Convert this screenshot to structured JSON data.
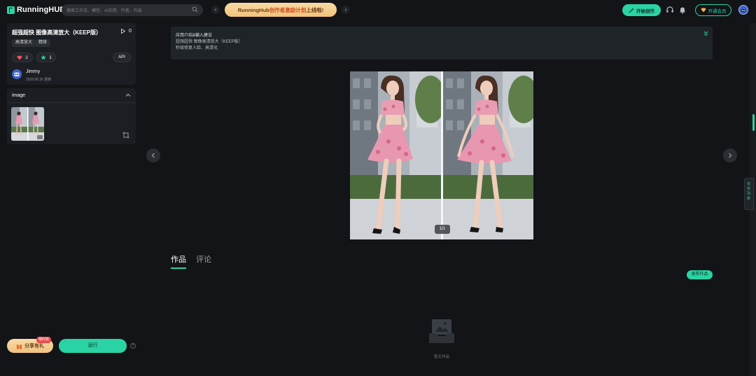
{
  "header": {
    "brand": "RunningHUB",
    "search_placeholder": "搜索工作流、模型、AI应用、作者、作品",
    "promo": {
      "prefix": "RunningHub",
      "highlight": "创作者激励计划",
      "suffix": "上线啦!"
    },
    "create_label": "开始创作",
    "member_label": "开通会员"
  },
  "workflow": {
    "title": "超强超快 图像高清放大（KEEP版）",
    "play_count": "0",
    "tags": [
      "高清放大",
      "精修"
    ],
    "likes": "2",
    "favorites": "1",
    "api_label": "API",
    "author": {
      "name": "Jimmy",
      "updated": "2025.06.26 更新"
    }
  },
  "inputs": {
    "section_label": "image"
  },
  "bottom": {
    "share_label": "分享有礼",
    "share_badge": "限时抢",
    "run_label": "运行"
  },
  "intro": {
    "heading": "应用介绍&输入建议",
    "line1": "超强超快 图像高清放大（KEEP版）",
    "line2": "秒级修复人脸、高清化"
  },
  "preview": {
    "page_indicator": "1/1"
  },
  "tabs": [
    {
      "label": "作品",
      "active": true
    },
    {
      "label": "评论",
      "active": false
    }
  ],
  "works": {
    "publish_label": "发布作品",
    "empty_text": "暂无作品"
  },
  "float_tab": {
    "label": "任务列表"
  },
  "colors": {
    "accent": "#2ad3a3",
    "background": "#121417",
    "panel": "#1b1e22",
    "promo": "#f1c27a"
  }
}
